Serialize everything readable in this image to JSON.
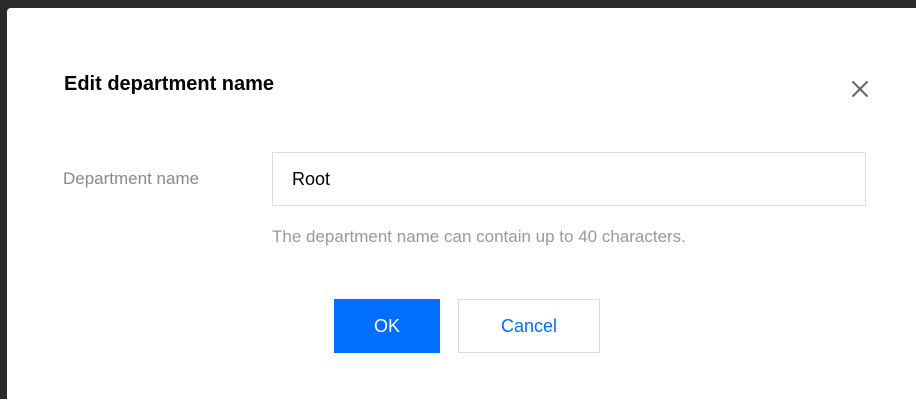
{
  "dialog": {
    "title": "Edit department name",
    "close_icon": "close-icon"
  },
  "form": {
    "department_label": "Department name",
    "department_value": "Root",
    "hint": "The department name can contain up to 40 characters."
  },
  "actions": {
    "ok_label": "OK",
    "cancel_label": "Cancel"
  },
  "colors": {
    "primary": "#006eff",
    "label_gray": "#888888",
    "hint_gray": "#999999",
    "border": "#dcdcdc"
  }
}
